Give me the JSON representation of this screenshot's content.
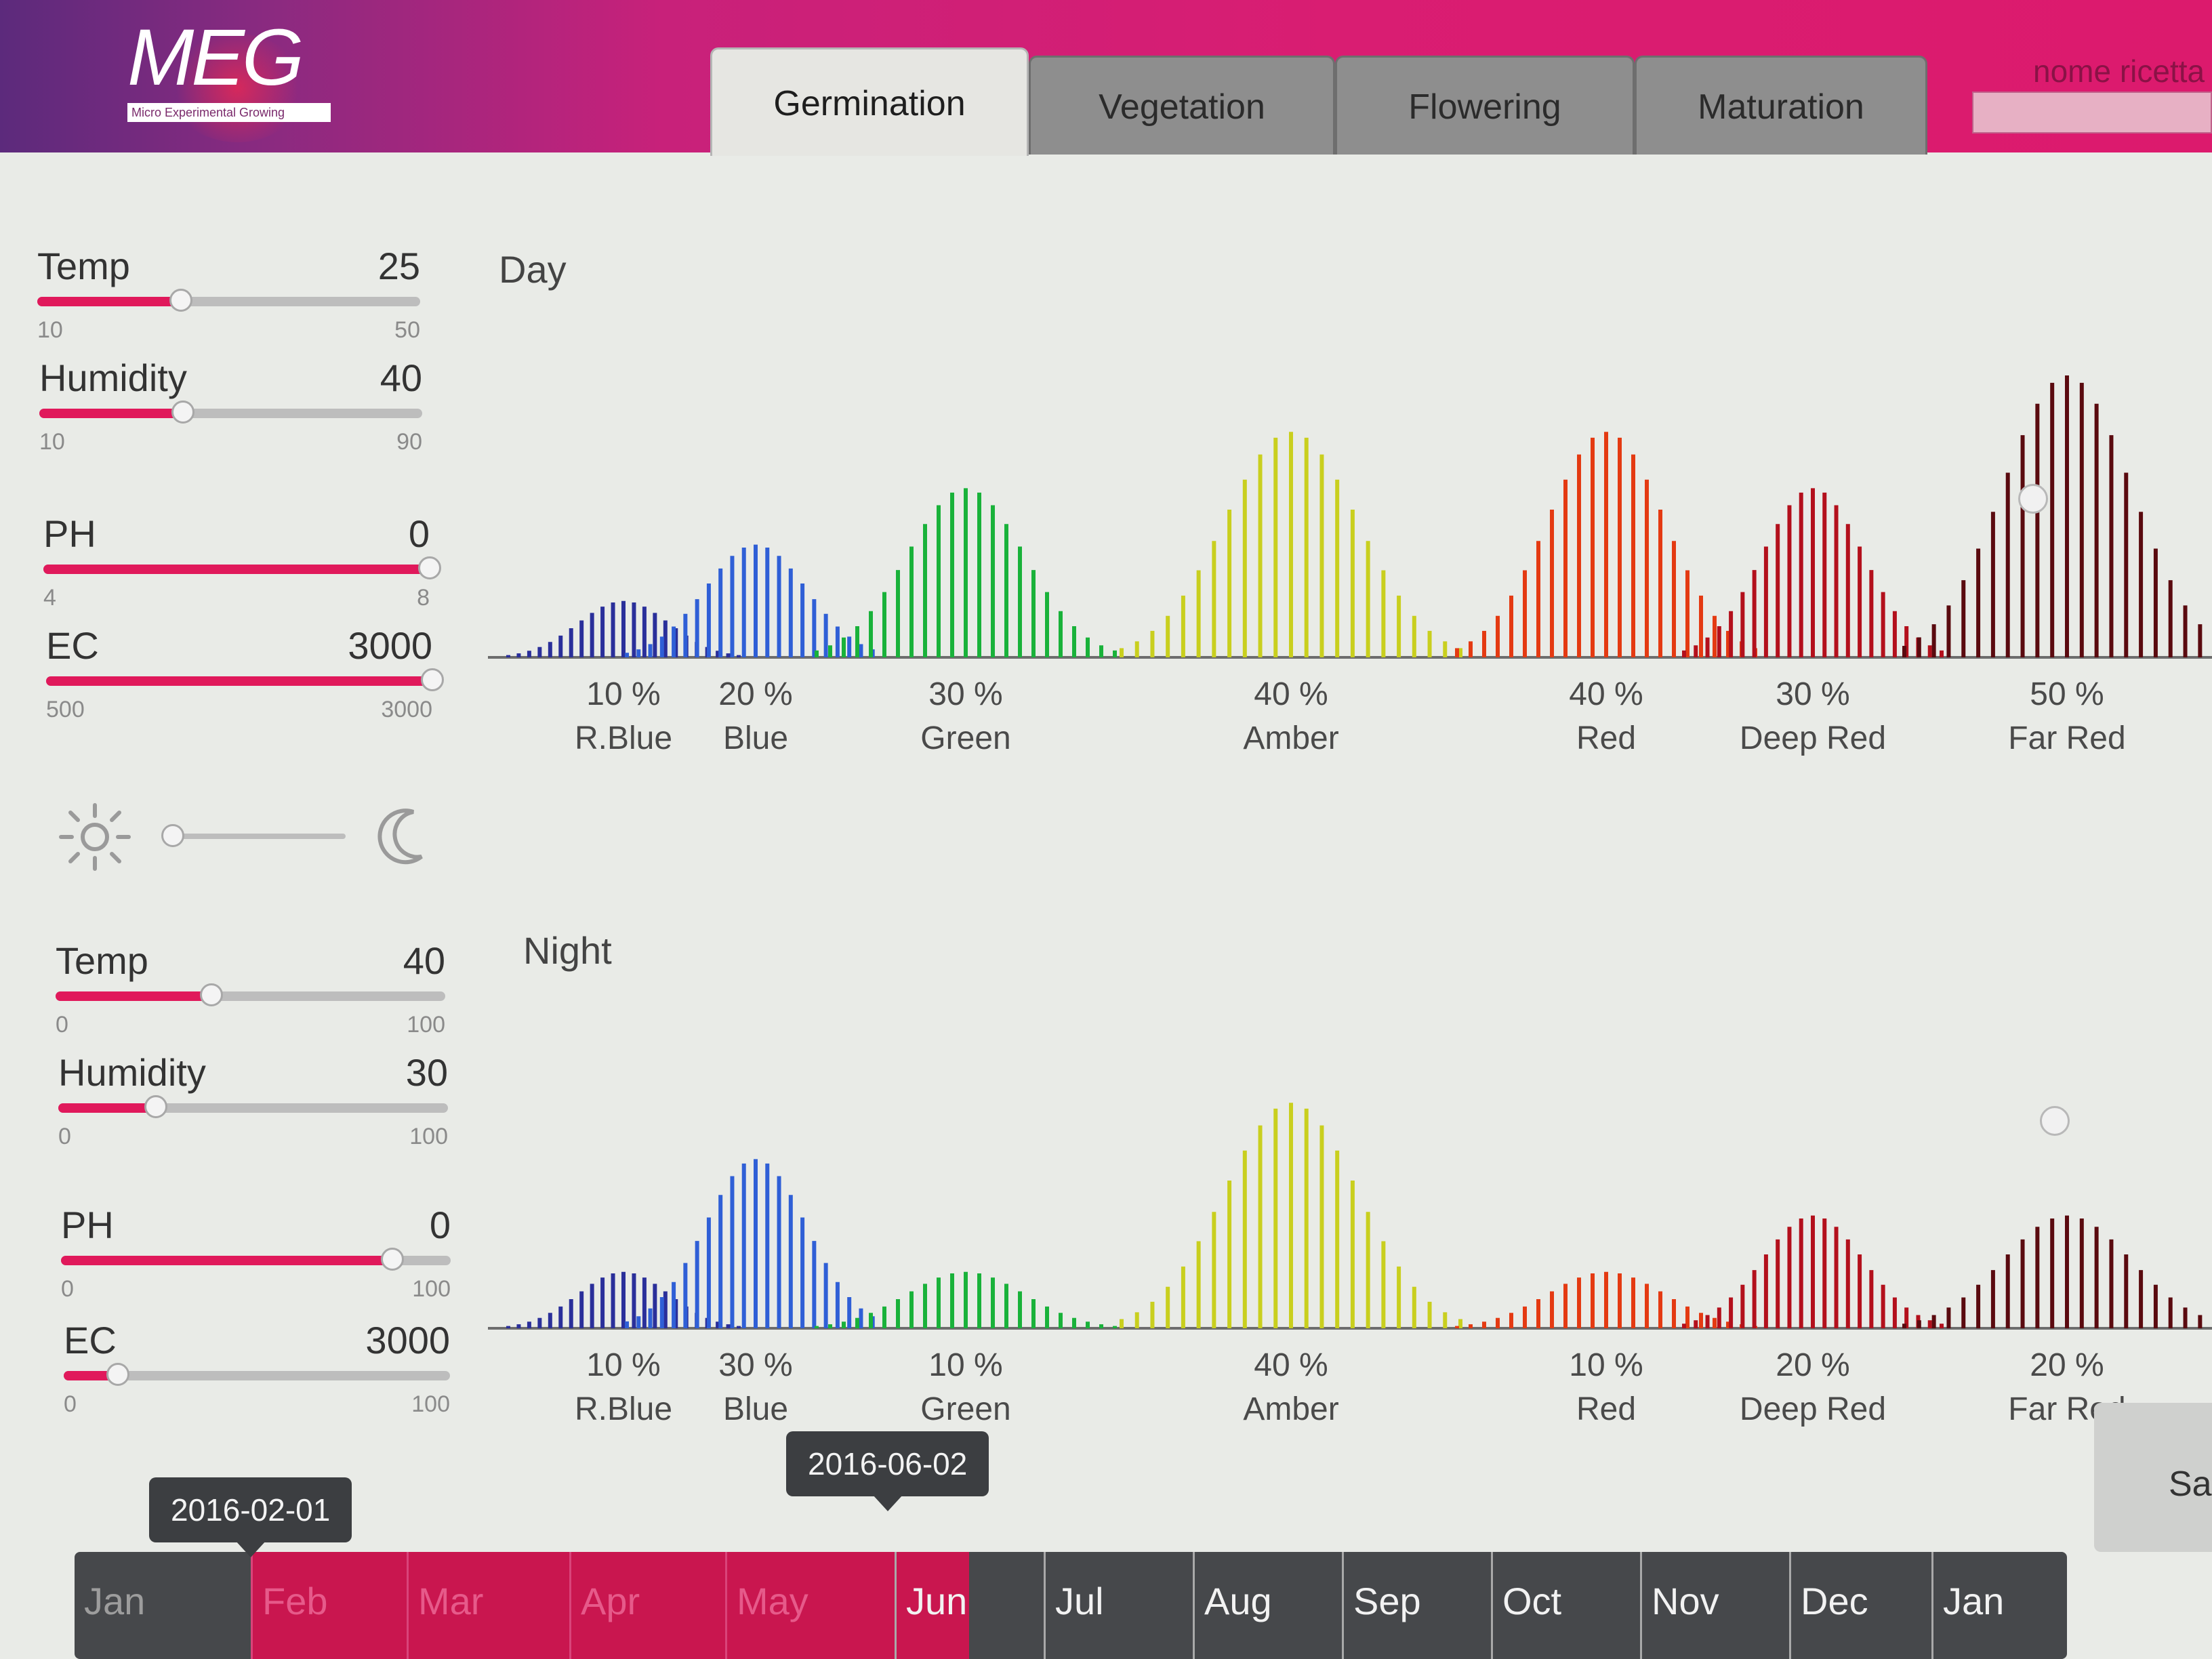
{
  "app": {
    "logo_text": "MEG",
    "logo_subtitle": "Micro Experimental Growing",
    "tabs": [
      {
        "label": "Germination",
        "active": true
      },
      {
        "label": "Vegetation",
        "active": false
      },
      {
        "label": "Flowering",
        "active": false
      },
      {
        "label": "Maturation",
        "active": false
      }
    ],
    "recipe_name_label": "nome ricetta",
    "colors": {
      "accent": "#e0195b",
      "header": "#d91d72",
      "track": "#bdbdbd",
      "timeline": "#46484b"
    }
  },
  "day": {
    "title": "Day",
    "sliders": {
      "temp": {
        "label": "Temp",
        "value": "25",
        "min": "10",
        "max": "50",
        "fraction": 0.375
      },
      "humidity": {
        "label": "Humidity",
        "value": "40",
        "min": "10",
        "max": "90",
        "fraction": 0.375
      },
      "ph": {
        "label": "PH",
        "value": "0",
        "min": "4",
        "max": "8",
        "fraction": 1.0
      },
      "ec": {
        "label": "EC",
        "value": "3000",
        "min": "500",
        "max": "3000",
        "fraction": 1.0
      }
    },
    "bands": [
      {
        "pct": "10 %",
        "name": "R.Blue",
        "level": 0.1,
        "color": "#2a2f9a"
      },
      {
        "pct": "20 %",
        "name": "Blue",
        "level": 0.2,
        "color": "#2f5fd6"
      },
      {
        "pct": "30 %",
        "name": "Green",
        "level": 0.3,
        "color": "#19b23a"
      },
      {
        "pct": "40 %",
        "name": "Amber",
        "level": 0.4,
        "color": "#c9cf1e"
      },
      {
        "pct": "40 %",
        "name": "Red",
        "level": 0.4,
        "color": "#e43a12"
      },
      {
        "pct": "30 %",
        "name": "Deep Red",
        "level": 0.3,
        "color": "#b3101c"
      },
      {
        "pct": "50 %",
        "name": "Far Red",
        "level": 0.5,
        "color": "#5a0a0f"
      }
    ]
  },
  "toggle": {
    "left_icon": "sun-icon",
    "right_icon": "moon-icon",
    "position": 0.0
  },
  "night": {
    "title": "Night",
    "sliders": {
      "temp": {
        "label": "Temp",
        "value": "40",
        "min": "0",
        "max": "100",
        "fraction": 0.4
      },
      "humidity": {
        "label": "Humidity",
        "value": "30",
        "min": "0",
        "max": "100",
        "fraction": 0.25
      },
      "ph": {
        "label": "PH",
        "value": "0",
        "min": "0",
        "max": "100",
        "fraction": 0.85
      },
      "ec": {
        "label": "EC",
        "value": "3000",
        "min": "0",
        "max": "100",
        "fraction": 0.14
      }
    },
    "bands": [
      {
        "pct": "10 %",
        "name": "R.Blue",
        "level": 0.1,
        "color": "#2a2f9a"
      },
      {
        "pct": "30 %",
        "name": "Blue",
        "level": 0.3,
        "color": "#2f5fd6"
      },
      {
        "pct": "10 %",
        "name": "Green",
        "level": 0.1,
        "color": "#19b23a"
      },
      {
        "pct": "40 %",
        "name": "Amber",
        "level": 0.4,
        "color": "#c9cf1e"
      },
      {
        "pct": "10 %",
        "name": "Red",
        "level": 0.1,
        "color": "#e43a12"
      },
      {
        "pct": "20 %",
        "name": "Deep Red",
        "level": 0.2,
        "color": "#b3101c"
      },
      {
        "pct": "20 %",
        "name": "Far Red",
        "level": 0.2,
        "color": "#5a0a0f"
      }
    ]
  },
  "timeline": {
    "months": [
      "Jan",
      "Feb",
      "Mar",
      "Apr",
      "May",
      "Jun",
      "Jul",
      "Aug",
      "Sep",
      "Oct",
      "Nov",
      "Dec",
      "Jan"
    ],
    "start_date": "2016-02-01",
    "end_date": "2016-06-02"
  },
  "save_label": "Sa"
}
